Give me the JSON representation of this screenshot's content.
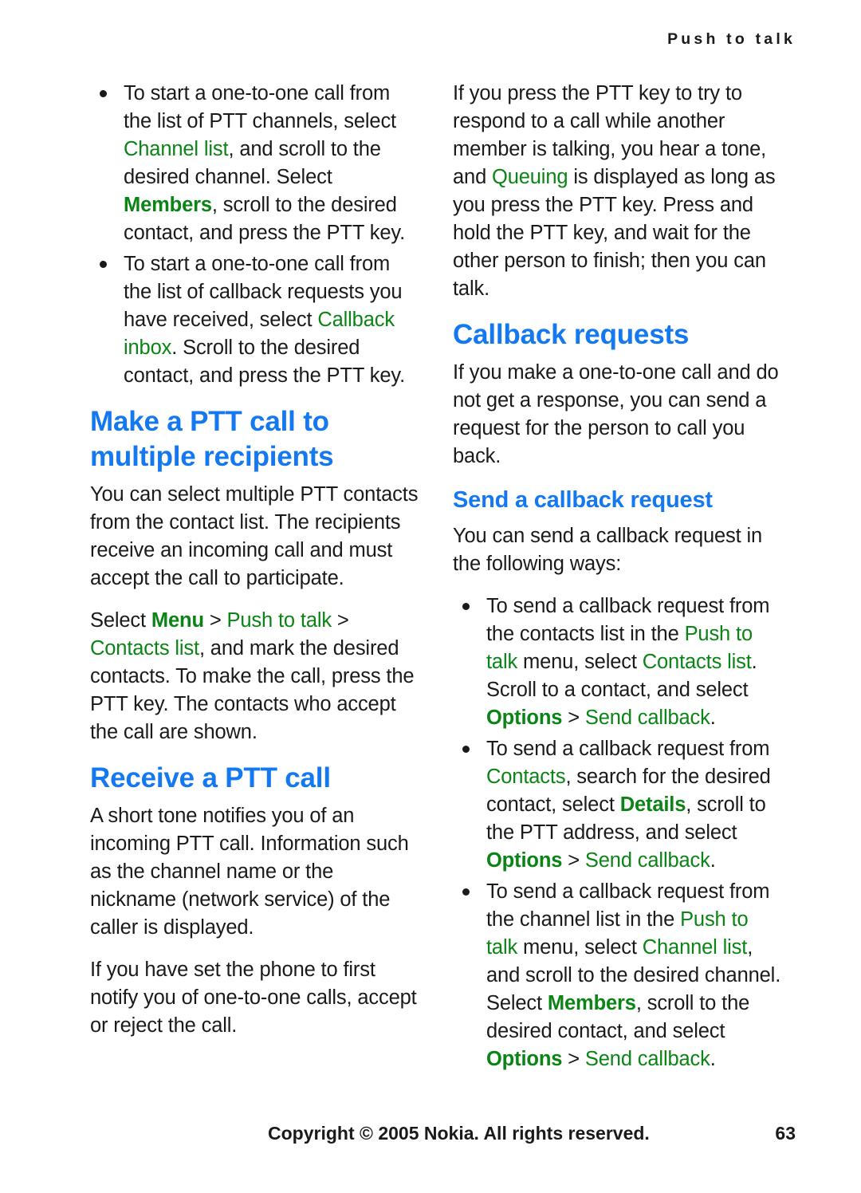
{
  "header": {
    "running_title": "Push to talk"
  },
  "left_column": {
    "bullets_top": [
      {
        "segments": [
          {
            "text": "To start a one-to-one call from the list of PTT channels, select ",
            "style": "plain"
          },
          {
            "text": "Channel list",
            "style": "ui"
          },
          {
            "text": ", and scroll to the desired channel. Select ",
            "style": "plain"
          },
          {
            "text": "Members",
            "style": "ui-bold"
          },
          {
            "text": ", scroll to the desired contact, and press the PTT key.",
            "style": "plain"
          }
        ]
      },
      {
        "segments": [
          {
            "text": "To start a one-to-one call from the list of callback requests you have received, select ",
            "style": "plain"
          },
          {
            "text": "Callback inbox",
            "style": "ui"
          },
          {
            "text": ". Scroll to the desired contact, and press the PTT key.",
            "style": "plain"
          }
        ]
      }
    ],
    "heading_multiple_recipients": "Make a PTT call to multiple recipients",
    "para_multiple_recipients": "You can select multiple PTT contacts from the contact list. The recipients receive an incoming call and must accept the call to participate.",
    "para_select_menu": {
      "segments": [
        {
          "text": "Select ",
          "style": "plain"
        },
        {
          "text": "Menu",
          "style": "ui-bold"
        },
        {
          "text": " > ",
          "style": "sep"
        },
        {
          "text": "Push to talk",
          "style": "ui"
        },
        {
          "text": " > ",
          "style": "sep"
        },
        {
          "text": "Contacts list",
          "style": "ui"
        },
        {
          "text": ", and mark the desired contacts. To make the call, press the PTT key. The contacts who accept the call are shown.",
          "style": "plain"
        }
      ]
    },
    "heading_receive": "Receive a PTT call",
    "para_receive_1": "A short tone notifies you of an incoming PTT call. Information such as the channel name or the nickname (network service) of the caller is displayed.",
    "para_receive_2": "If you have set the phone to first notify you of one-to-one calls, accept or reject the call."
  },
  "right_column": {
    "para_queuing": {
      "segments": [
        {
          "text": "If you press the PTT key to try to respond to a call while another member is talking, you hear a tone, and ",
          "style": "plain"
        },
        {
          "text": "Queuing",
          "style": "ui"
        },
        {
          "text": " is displayed as long as you press the PTT key. Press and hold the PTT key, and wait for the other person to finish; then you can talk.",
          "style": "plain"
        }
      ]
    },
    "heading_callback_requests": "Callback requests",
    "para_callback_requests": "If you make a one-to-one call and do not get a response, you can send a request for the person to call you back.",
    "heading_send_callback": "Send a callback request",
    "para_send_callback_intro": "You can send a callback request in the following ways:",
    "bullets": [
      {
        "segments": [
          {
            "text": "To send a callback request from the contacts list in the ",
            "style": "plain"
          },
          {
            "text": "Push to talk",
            "style": "ui"
          },
          {
            "text": " menu, select ",
            "style": "plain"
          },
          {
            "text": "Contacts list",
            "style": "ui"
          },
          {
            "text": ". Scroll to a contact, and select ",
            "style": "plain"
          },
          {
            "text": "Options",
            "style": "ui-bold"
          },
          {
            "text": " > ",
            "style": "sep"
          },
          {
            "text": "Send callback",
            "style": "ui"
          },
          {
            "text": ".",
            "style": "plain"
          }
        ]
      },
      {
        "segments": [
          {
            "text": "To send a callback request from ",
            "style": "plain"
          },
          {
            "text": "Contacts",
            "style": "ui"
          },
          {
            "text": ", search for the desired contact, select ",
            "style": "plain"
          },
          {
            "text": "Details",
            "style": "ui-bold"
          },
          {
            "text": ", scroll to the PTT address, and select ",
            "style": "plain"
          },
          {
            "text": "Options",
            "style": "ui-bold"
          },
          {
            "text": " > ",
            "style": "sep"
          },
          {
            "text": "Send callback",
            "style": "ui"
          },
          {
            "text": ".",
            "style": "plain"
          }
        ]
      },
      {
        "segments": [
          {
            "text": "To send a callback request from the channel list in the ",
            "style": "plain"
          },
          {
            "text": "Push to talk",
            "style": "ui"
          },
          {
            "text": " menu, select ",
            "style": "plain"
          },
          {
            "text": "Channel list",
            "style": "ui"
          },
          {
            "text": ", and scroll to the desired channel. Select ",
            "style": "plain"
          },
          {
            "text": "Members",
            "style": "ui-bold"
          },
          {
            "text": ", scroll to the desired contact, and select ",
            "style": "plain"
          },
          {
            "text": "Options",
            "style": "ui-bold"
          },
          {
            "text": " > ",
            "style": "sep"
          },
          {
            "text": "Send callback",
            "style": "ui"
          },
          {
            "text": ".",
            "style": "plain"
          }
        ]
      }
    ]
  },
  "footer": {
    "copyright": "Copyright © 2005 Nokia. All rights reserved.",
    "page_number": "63"
  },
  "colors": {
    "heading_blue": "#1478f0",
    "ui_green": "#0a8415",
    "body_black": "#1a1a1a"
  }
}
